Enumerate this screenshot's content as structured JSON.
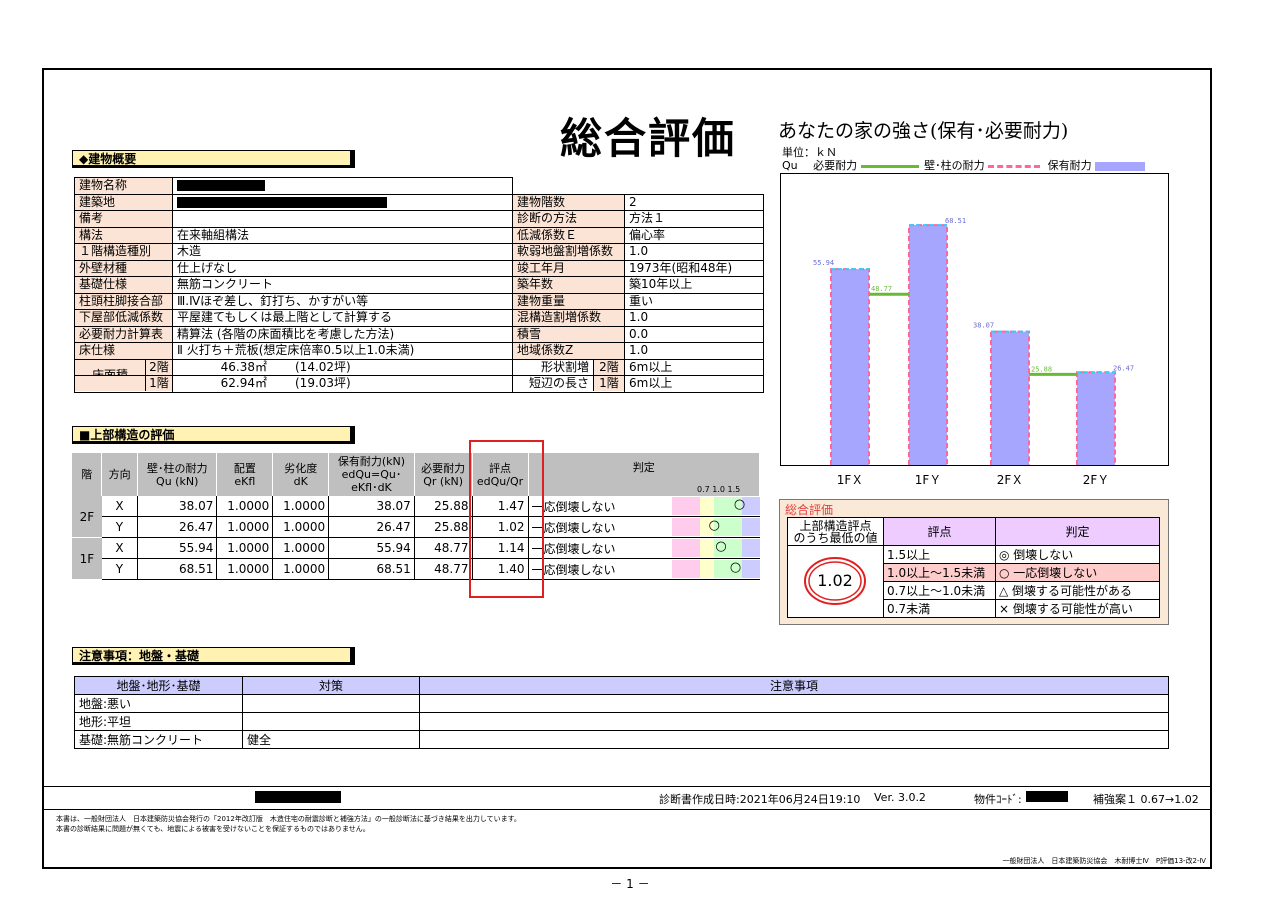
{
  "title": "総合評価",
  "building_overview": {
    "section_label": "◆建物概要",
    "rows_left": [
      {
        "label": "建物名称",
        "value": ""
      },
      {
        "label": "建築地",
        "value": ""
      },
      {
        "label": "備考",
        "value": ""
      },
      {
        "label": "構法",
        "value": "在来軸組構法"
      },
      {
        "label": "１階構造種別",
        "value": "木造"
      },
      {
        "label": "外壁材種",
        "value": "仕上げなし"
      },
      {
        "label": "基礎仕様",
        "value": "無筋コンクリート"
      },
      {
        "label": "柱頭柱脚接合部",
        "value": "Ⅲ.Ⅳほぞ差し、釘打ち、かすがい等"
      },
      {
        "label": "下屋部低減係数",
        "value": "平屋建てもしくは最上階として計算する"
      },
      {
        "label": "必要耐力計算表",
        "value": "精算法 (各階の床面積比を考慮した方法)"
      },
      {
        "label": "床仕様",
        "value": "Ⅱ 火打ち＋荒板(想定床倍率0.5以上1.0未満)"
      }
    ],
    "rows_right": [
      {
        "label": "建物階数",
        "value": "2"
      },
      {
        "label": "診断の方法",
        "value": "方法１"
      },
      {
        "label": "低減係数Ｅ",
        "value": "偏心率"
      },
      {
        "label": "軟弱地盤割増係数",
        "value": "1.0"
      },
      {
        "label": "竣工年月",
        "value": "1973年(昭和48年)"
      },
      {
        "label": "築年数",
        "value": "築10年以上"
      },
      {
        "label": "建物重量",
        "value": "重い"
      },
      {
        "label": "混構造割増係数",
        "value": "1.0"
      },
      {
        "label": "積雪",
        "value": "0.0"
      },
      {
        "label": "地域係数Z",
        "value": "1.0"
      }
    ],
    "floor_area_label": "床面積",
    "floor_area": [
      {
        "floor": "2階",
        "m2": "46.38㎡",
        "tsubo": "(14.02坪)"
      },
      {
        "floor": "1階",
        "m2": "62.94㎡",
        "tsubo": "(19.03坪)"
      }
    ],
    "shape_rows": [
      {
        "label": "形状割増",
        "floor": "2階",
        "value": "6m以上"
      },
      {
        "label": "短辺の長さ",
        "floor": "1階",
        "value": "6m以上"
      }
    ]
  },
  "upper_eval": {
    "section_label": "■上部構造の評価",
    "headers": [
      "階",
      "方向",
      "壁･柱の耐力\nQu (kN)",
      "配置\neKfl",
      "劣化度\ndK",
      "保有耐力(kN)\nedQu=Qu･eKfl･dK",
      "必要耐力\nQr (kN)",
      "評点\nedQu/Qr",
      "判定"
    ],
    "scale_labels": "0.7 1.0   1.5",
    "rows": [
      {
        "floor": "2F",
        "dir": "X",
        "qu": "38.07",
        "ekfl": "1.0000",
        "dk": "1.0000",
        "edqu": "38.07",
        "qr": "25.88",
        "score": "1.47",
        "judge": "一応倒壊しない",
        "mark": "○",
        "pos": 1.47
      },
      {
        "floor": "",
        "dir": "Y",
        "qu": "26.47",
        "ekfl": "1.0000",
        "dk": "1.0000",
        "edqu": "26.47",
        "qr": "25.88",
        "score": "1.02",
        "judge": "一応倒壊しない",
        "mark": "○",
        "pos": 1.02
      },
      {
        "floor": "1F",
        "dir": "X",
        "qu": "55.94",
        "ekfl": "1.0000",
        "dk": "1.0000",
        "edqu": "55.94",
        "qr": "48.77",
        "score": "1.14",
        "judge": "一応倒壊しない",
        "mark": "○",
        "pos": 1.14
      },
      {
        "floor": "",
        "dir": "Y",
        "qu": "68.51",
        "ekfl": "1.0000",
        "dk": "1.0000",
        "edqu": "68.51",
        "qr": "48.77",
        "score": "1.40",
        "judge": "一応倒壊しない",
        "mark": "○",
        "pos": 1.4
      }
    ]
  },
  "chart_data": {
    "type": "bar",
    "title": "あなたの家の強さ(保有･必要耐力)",
    "unit": "単位：ｋＮ",
    "qu_label": "Qu",
    "legend": [
      "必要耐力",
      "壁･柱の耐力",
      "保有耐力"
    ],
    "categories": [
      "1FＸ",
      "1FＹ",
      "2FＸ",
      "2FＹ"
    ],
    "series": [
      {
        "name": "保有耐力",
        "values": [
          55.94,
          68.51,
          38.07,
          26.47
        ]
      },
      {
        "name": "壁･柱の耐力",
        "values": [
          55.94,
          68.51,
          38.07,
          26.47
        ]
      },
      {
        "name": "必要耐力",
        "values": [
          48.77,
          48.77,
          25.88,
          25.88
        ]
      }
    ],
    "value_labels": [
      "55.94",
      "68.51",
      "38.07",
      "26.47"
    ],
    "required_labels": [
      "48.77",
      "25.88"
    ],
    "ylim": [
      0,
      80
    ],
    "colors": {
      "holding": "#a6a6ff",
      "wall": "#ff6699",
      "required": "#66bb33",
      "outline": "#33ccff"
    }
  },
  "overall": {
    "title": "総合評価",
    "min_label_1": "上部構造評点",
    "min_label_2": "のうち最低の値",
    "min_value": "1.02",
    "score_header": "評点",
    "judge_header": "判定",
    "rows": [
      {
        "score": "1.5以上",
        "judge": "◎ 倒壊しない"
      },
      {
        "score": "1.0以上～1.5未満",
        "judge": "○ 一応倒壊しない"
      },
      {
        "score": "0.7以上～1.0未満",
        "judge": "△ 倒壊する可能性がある"
      },
      {
        "score": "0.7未満",
        "judge": "× 倒壊する可能性が高い"
      }
    ]
  },
  "notes": {
    "section_label": "注意事項：地盤・基礎",
    "headers": [
      "地盤･地形･基礎",
      "対策",
      "注意事項"
    ],
    "rows": [
      {
        "a": "地盤:悪い",
        "b": "",
        "c": ""
      },
      {
        "a": "地形:平坦",
        "b": "",
        "c": ""
      },
      {
        "a": "基礎:無筋コンクリート",
        "b": "健全",
        "c": ""
      }
    ]
  },
  "footer": {
    "created": "診断書作成日時:2021年06月24日19:10",
    "version": "Ver. 3.0.2",
    "code_label": "物件ｺｰﾄﾞ:",
    "plan": "補強案１ 0.67→1.02",
    "disclaimer1": "本書は、一般財団法人　日本建築防災協会発行の「2012年改訂版　木造住宅の耐震診断と補強方法」の一般診断法に基づき結果を出力しています。",
    "disclaimer2": "本書の診断結果に問題が無くても、地震による被害を受けないことを保証するものではありません。",
    "publisher": "一般財団法人　日本建築防災協会　木耐博士Ⅳ　P評価13-改2-Ⅳ",
    "page": "－ 1 －"
  }
}
